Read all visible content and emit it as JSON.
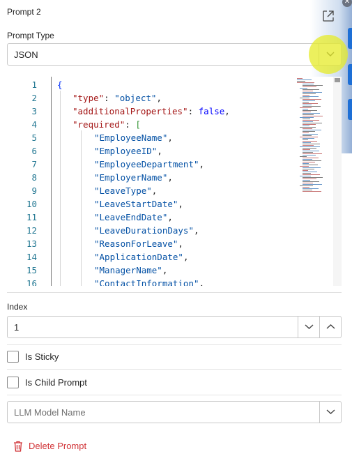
{
  "header": {
    "title": "Prompt 2",
    "open_icon": "open-in-new-window-icon"
  },
  "prompt_type": {
    "label": "Prompt Type",
    "value": "JSON"
  },
  "editor": {
    "lines": [
      {
        "num": "1"
      },
      {
        "num": "2"
      },
      {
        "num": "3"
      },
      {
        "num": "4"
      },
      {
        "num": "5"
      },
      {
        "num": "6"
      },
      {
        "num": "7"
      },
      {
        "num": "8"
      },
      {
        "num": "9"
      },
      {
        "num": "10"
      },
      {
        "num": "11"
      },
      {
        "num": "12"
      },
      {
        "num": "13"
      },
      {
        "num": "14"
      },
      {
        "num": "15"
      },
      {
        "num": "16"
      }
    ],
    "tokens": {
      "l1": "{",
      "l2k": "\"type\"",
      "l2v": "\"object\"",
      "l3k": "\"additionalProperties\"",
      "l3v": "false",
      "l4k": "\"required\"",
      "l4v": "[",
      "l5": "\"EmployeeName\"",
      "l6": "\"EmployeeID\"",
      "l7": "\"EmployeeDepartment\"",
      "l8": "\"EmployerName\"",
      "l9": "\"LeaveType\"",
      "l10": "\"LeaveStartDate\"",
      "l11": "\"LeaveEndDate\"",
      "l12": "\"LeaveDurationDays\"",
      "l13": "\"ReasonForLeave\"",
      "l14": "\"ApplicationDate\"",
      "l15": "\"ManagerName\"",
      "l16": "\"ContactInformation\""
    },
    "colors": {
      "key": "#a31515",
      "string": "#0451a5",
      "boolean": "#0000ff",
      "line_number": "#237893"
    }
  },
  "index": {
    "label": "Index",
    "value": "1"
  },
  "is_sticky": {
    "label": "Is Sticky",
    "checked": false
  },
  "is_child_prompt": {
    "label": "Is Child Prompt",
    "checked": false
  },
  "llm_model": {
    "placeholder": "LLM Model Name"
  },
  "delete": {
    "label": "Delete Prompt",
    "color": "#d13438",
    "icon": "trash-icon"
  }
}
